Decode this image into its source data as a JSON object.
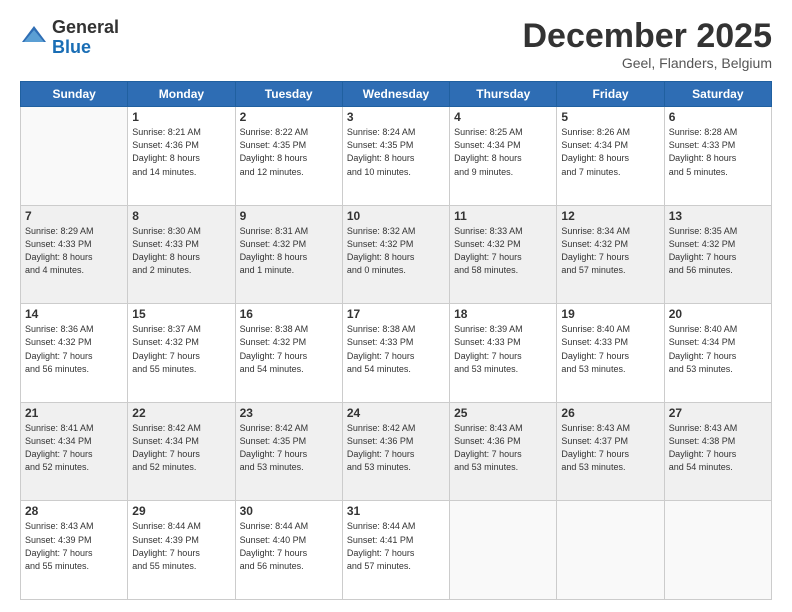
{
  "header": {
    "logo_line1": "General",
    "logo_line2": "Blue",
    "month": "December 2025",
    "location": "Geel, Flanders, Belgium"
  },
  "days_of_week": [
    "Sunday",
    "Monday",
    "Tuesday",
    "Wednesday",
    "Thursday",
    "Friday",
    "Saturday"
  ],
  "weeks": [
    [
      {
        "day": "",
        "info": ""
      },
      {
        "day": "1",
        "info": "Sunrise: 8:21 AM\nSunset: 4:36 PM\nDaylight: 8 hours\nand 14 minutes."
      },
      {
        "day": "2",
        "info": "Sunrise: 8:22 AM\nSunset: 4:35 PM\nDaylight: 8 hours\nand 12 minutes."
      },
      {
        "day": "3",
        "info": "Sunrise: 8:24 AM\nSunset: 4:35 PM\nDaylight: 8 hours\nand 10 minutes."
      },
      {
        "day": "4",
        "info": "Sunrise: 8:25 AM\nSunset: 4:34 PM\nDaylight: 8 hours\nand 9 minutes."
      },
      {
        "day": "5",
        "info": "Sunrise: 8:26 AM\nSunset: 4:34 PM\nDaylight: 8 hours\nand 7 minutes."
      },
      {
        "day": "6",
        "info": "Sunrise: 8:28 AM\nSunset: 4:33 PM\nDaylight: 8 hours\nand 5 minutes."
      }
    ],
    [
      {
        "day": "7",
        "info": "Sunrise: 8:29 AM\nSunset: 4:33 PM\nDaylight: 8 hours\nand 4 minutes."
      },
      {
        "day": "8",
        "info": "Sunrise: 8:30 AM\nSunset: 4:33 PM\nDaylight: 8 hours\nand 2 minutes."
      },
      {
        "day": "9",
        "info": "Sunrise: 8:31 AM\nSunset: 4:32 PM\nDaylight: 8 hours\nand 1 minute."
      },
      {
        "day": "10",
        "info": "Sunrise: 8:32 AM\nSunset: 4:32 PM\nDaylight: 8 hours\nand 0 minutes."
      },
      {
        "day": "11",
        "info": "Sunrise: 8:33 AM\nSunset: 4:32 PM\nDaylight: 7 hours\nand 58 minutes."
      },
      {
        "day": "12",
        "info": "Sunrise: 8:34 AM\nSunset: 4:32 PM\nDaylight: 7 hours\nand 57 minutes."
      },
      {
        "day": "13",
        "info": "Sunrise: 8:35 AM\nSunset: 4:32 PM\nDaylight: 7 hours\nand 56 minutes."
      }
    ],
    [
      {
        "day": "14",
        "info": "Sunrise: 8:36 AM\nSunset: 4:32 PM\nDaylight: 7 hours\nand 56 minutes."
      },
      {
        "day": "15",
        "info": "Sunrise: 8:37 AM\nSunset: 4:32 PM\nDaylight: 7 hours\nand 55 minutes."
      },
      {
        "day": "16",
        "info": "Sunrise: 8:38 AM\nSunset: 4:32 PM\nDaylight: 7 hours\nand 54 minutes."
      },
      {
        "day": "17",
        "info": "Sunrise: 8:38 AM\nSunset: 4:33 PM\nDaylight: 7 hours\nand 54 minutes."
      },
      {
        "day": "18",
        "info": "Sunrise: 8:39 AM\nSunset: 4:33 PM\nDaylight: 7 hours\nand 53 minutes."
      },
      {
        "day": "19",
        "info": "Sunrise: 8:40 AM\nSunset: 4:33 PM\nDaylight: 7 hours\nand 53 minutes."
      },
      {
        "day": "20",
        "info": "Sunrise: 8:40 AM\nSunset: 4:34 PM\nDaylight: 7 hours\nand 53 minutes."
      }
    ],
    [
      {
        "day": "21",
        "info": "Sunrise: 8:41 AM\nSunset: 4:34 PM\nDaylight: 7 hours\nand 52 minutes."
      },
      {
        "day": "22",
        "info": "Sunrise: 8:42 AM\nSunset: 4:34 PM\nDaylight: 7 hours\nand 52 minutes."
      },
      {
        "day": "23",
        "info": "Sunrise: 8:42 AM\nSunset: 4:35 PM\nDaylight: 7 hours\nand 53 minutes."
      },
      {
        "day": "24",
        "info": "Sunrise: 8:42 AM\nSunset: 4:36 PM\nDaylight: 7 hours\nand 53 minutes."
      },
      {
        "day": "25",
        "info": "Sunrise: 8:43 AM\nSunset: 4:36 PM\nDaylight: 7 hours\nand 53 minutes."
      },
      {
        "day": "26",
        "info": "Sunrise: 8:43 AM\nSunset: 4:37 PM\nDaylight: 7 hours\nand 53 minutes."
      },
      {
        "day": "27",
        "info": "Sunrise: 8:43 AM\nSunset: 4:38 PM\nDaylight: 7 hours\nand 54 minutes."
      }
    ],
    [
      {
        "day": "28",
        "info": "Sunrise: 8:43 AM\nSunset: 4:39 PM\nDaylight: 7 hours\nand 55 minutes."
      },
      {
        "day": "29",
        "info": "Sunrise: 8:44 AM\nSunset: 4:39 PM\nDaylight: 7 hours\nand 55 minutes."
      },
      {
        "day": "30",
        "info": "Sunrise: 8:44 AM\nSunset: 4:40 PM\nDaylight: 7 hours\nand 56 minutes."
      },
      {
        "day": "31",
        "info": "Sunrise: 8:44 AM\nSunset: 4:41 PM\nDaylight: 7 hours\nand 57 minutes."
      },
      {
        "day": "",
        "info": ""
      },
      {
        "day": "",
        "info": ""
      },
      {
        "day": "",
        "info": ""
      }
    ]
  ]
}
